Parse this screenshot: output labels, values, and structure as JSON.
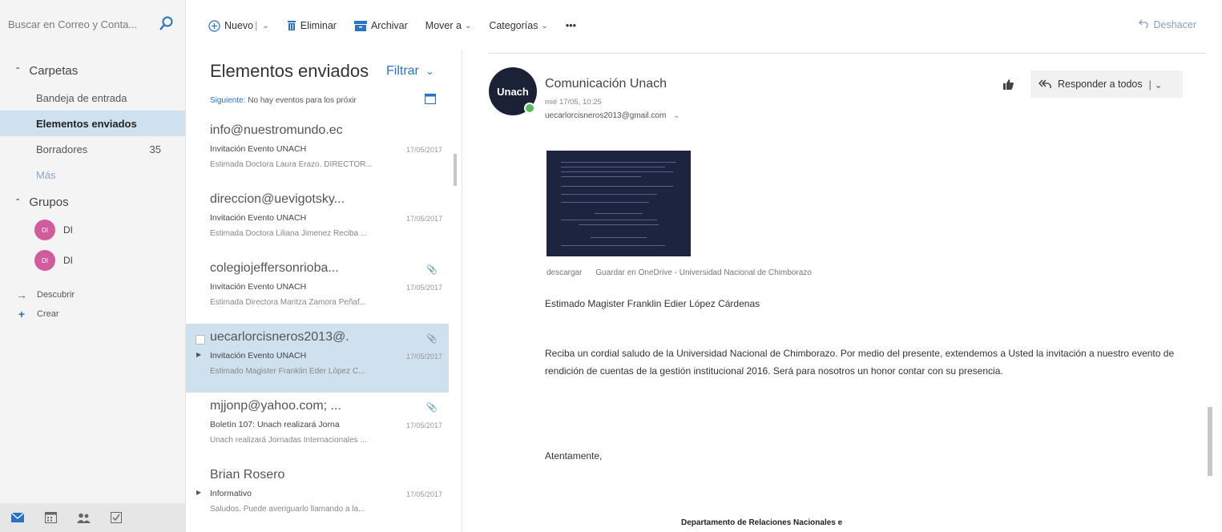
{
  "search": {
    "placeholder": "Buscar en Correo y Conta..."
  },
  "toolbar": {
    "new_label": "Nuevo",
    "delete_label": "Eliminar",
    "archive_label": "Archivar",
    "move_label": "Mover a",
    "categories_label": "Categorías",
    "more_label": "•••",
    "undo_label": "Deshacer"
  },
  "nav": {
    "folders_label": "Carpetas",
    "items": [
      {
        "label": "Bandeja de entrada",
        "count": ""
      },
      {
        "label": "Elementos enviados",
        "count": ""
      },
      {
        "label": "Borradores",
        "count": "35"
      }
    ],
    "more_label": "Más",
    "groups_label": "Grupos",
    "groups": [
      {
        "initials": "DI",
        "name": "DI"
      },
      {
        "initials": "DI",
        "name": "DI"
      }
    ],
    "discover_label": "Descubrir",
    "create_label": "Crear"
  },
  "list": {
    "title": "Elementos enviados",
    "filter_label": "Filtrar",
    "next_event_prefix": "Siguiente:",
    "next_event_text": "No hay eventos para los próxir",
    "messages": [
      {
        "from": "info@nuestromundo.ec",
        "subject": "Invitación Evento UNACH",
        "date": "17/05/2017",
        "preview": "Estimada Doctora Laura Erazo. DIRECTOR..."
      },
      {
        "from": "direccion@uevigotsky...",
        "subject": "Invitación Evento UNACH",
        "date": "17/05/2017",
        "preview": "Estimada Doctora Liliana Jimenez  Reciba ..."
      },
      {
        "from": "colegiojeffersonrioba...",
        "subject": "Invitación Evento UNACH",
        "date": "17/05/2017",
        "preview": "Estimada Directora Maritza Zamora Peñaf..."
      },
      {
        "from": "uecarlorcisneros2013@.",
        "subject": "Invitación Evento UNACH",
        "date": "17/05/2017",
        "preview": "Estimado Magister Franklin Eder López C..."
      },
      {
        "from": "mjjonp@yahoo.com; ...",
        "subject": "Boletín 107: Unach realizará Jorna",
        "date": "17/05/2017",
        "preview": "Unach realizará Jornadas Internacionales ..."
      },
      {
        "from": "Brian Rosero",
        "subject": "Informativo",
        "date": "17/05/2017",
        "preview": "Saludos. Puede averiguarlo llamando a la..."
      }
    ]
  },
  "reading": {
    "avatar_text": "Unach",
    "sender_name": "Comunicación Unach",
    "sent_date": "mié 17/05, 10:25",
    "to": "uecarlorcisneros2013@gmail.com",
    "reply_all_label": "Responder a todos",
    "attachment_actions": {
      "download": "descargar",
      "save_onedrive": "Guardar en OneDrive - Universidad Nacional de Chimborazo"
    },
    "greeting": "Estimado Magister Franklin Edier López Cárdenas",
    "body": "Reciba un cordial saludo de la Universidad Nacional de Chimborazo. Por medio del presente, extendemos a Usted la invitación a nuestro evento de rendición de cuentas de la gestión institucional 2016. Será para nosotros un honor contar con su presencia.",
    "closing": "Atentamente,",
    "footer": "Departamento de Relaciones Nacionales e"
  },
  "colors": {
    "accent": "#2a72c4",
    "selected": "#cfe0ef",
    "group_avatar": "#d15b9d",
    "sender_avatar": "#1b2236"
  }
}
